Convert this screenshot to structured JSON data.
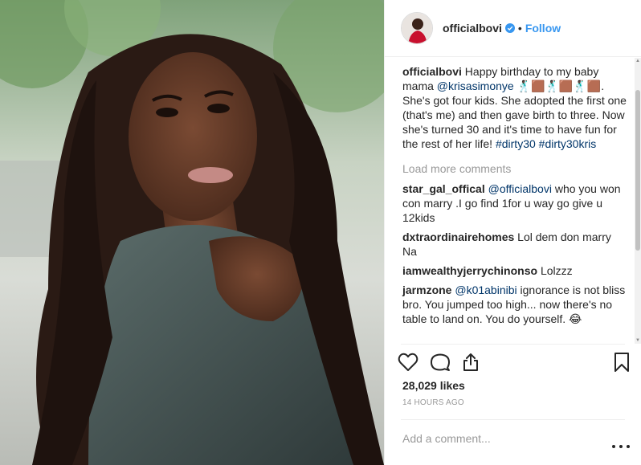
{
  "post": {
    "author": "officialbovi",
    "follow_label": "Follow",
    "separator": "•",
    "caption": {
      "user": "officialbovi",
      "text_1": "Happy birthday to my baby mama ",
      "mention": "@krisasimonye",
      "emoji": "🕺🏿🟫🕺🏿🟫🕺🏿🟫",
      "text_2": ". She's got four kids. She adopted the first one (that's me) and then gave birth to three. Now she's turned 30 and it's time to have fun for the rest of her life! ",
      "hashtag_1": "#dirty30",
      "hashtag_2": "#dirty30kris"
    },
    "load_more": "Load more comments",
    "comments": [
      {
        "user": "star_gal_offical",
        "mention": "@officialbovi",
        "text": " who you won con marry .I go find 1for u way go give u 12kids"
      },
      {
        "user": "dxtraordinairehomes",
        "mention": "",
        "text": "Lol dem don marry Na"
      },
      {
        "user": "iamwealthyjerrychinonso",
        "mention": "",
        "text": "Lolzzz"
      },
      {
        "user": "jarmzone",
        "mention": "@k01abinibi",
        "text": " ignorance is not bliss bro. You jumped too high... now there's no table to land on. You do yourself. 😂"
      }
    ],
    "likes": "28,029 likes",
    "timestamp": "14 HOURS AGO",
    "comment_placeholder": "Add a comment...",
    "icons": {
      "like": "heart-icon",
      "comment": "comment-bubble-icon",
      "share": "share-icon",
      "save": "bookmark-icon",
      "more": "more-options-icon",
      "verified": "verified-badge-icon"
    },
    "colors": {
      "accent": "#3897f0",
      "link": "#003569",
      "muted": "#999999",
      "text": "#262626",
      "border": "#efefef"
    }
  }
}
